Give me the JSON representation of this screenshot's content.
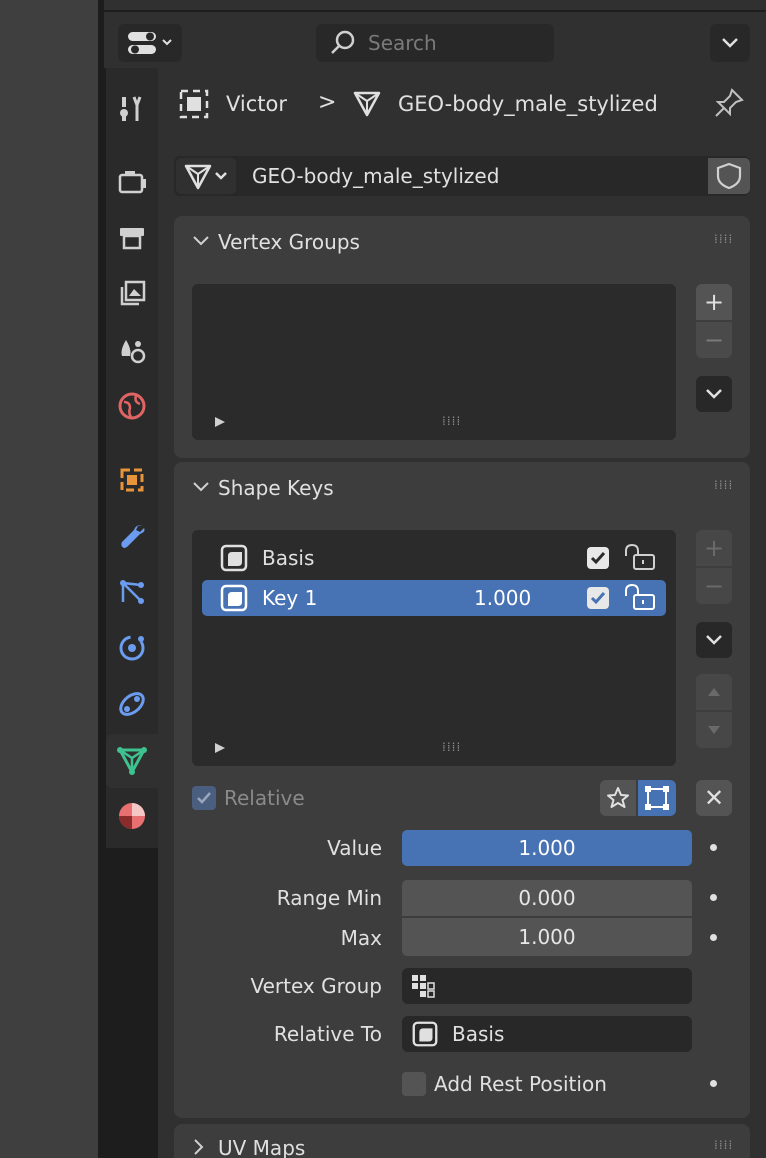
{
  "header": {
    "search_placeholder": "Search"
  },
  "breadcrumb": {
    "object": "Victor",
    "separator": ">",
    "mesh": "GEO-body_male_stylized"
  },
  "datablock": {
    "name": "GEO-body_male_stylized"
  },
  "vertex_groups": {
    "title": "Vertex Groups",
    "add": "+",
    "remove": "−"
  },
  "shape_keys": {
    "title": "Shape Keys",
    "items": [
      {
        "name": "Basis",
        "value": "",
        "checked": true
      },
      {
        "name": "Key 1",
        "value": "1.000",
        "checked": true
      }
    ],
    "add": "+",
    "remove": "−",
    "relative_label": "Relative",
    "clear": "✕"
  },
  "props": {
    "value_label": "Value",
    "value": "1.000",
    "value_fraction": 1.0,
    "range_min_label": "Range Min",
    "range_min": "0.000",
    "max_label": "Max",
    "max": "1.000",
    "vertex_group_label": "Vertex Group",
    "relative_to_label": "Relative To",
    "relative_to": "Basis",
    "add_rest_label": "Add Rest Position"
  },
  "uv_maps": {
    "title": "UV Maps"
  },
  "colors": {
    "accent_blue": "#4772b3",
    "mesh_tab_green": "#3ec28f",
    "panel_bg": "#3d3d3d"
  },
  "tabs": [
    "tool-icon",
    "render-icon",
    "output-icon",
    "view-layer-icon",
    "scene-icon",
    "world-icon",
    "object-icon",
    "modifier-icon",
    "particles-icon",
    "physics-icon",
    "constraints-icon",
    "mesh-data-icon",
    "material-icon"
  ]
}
